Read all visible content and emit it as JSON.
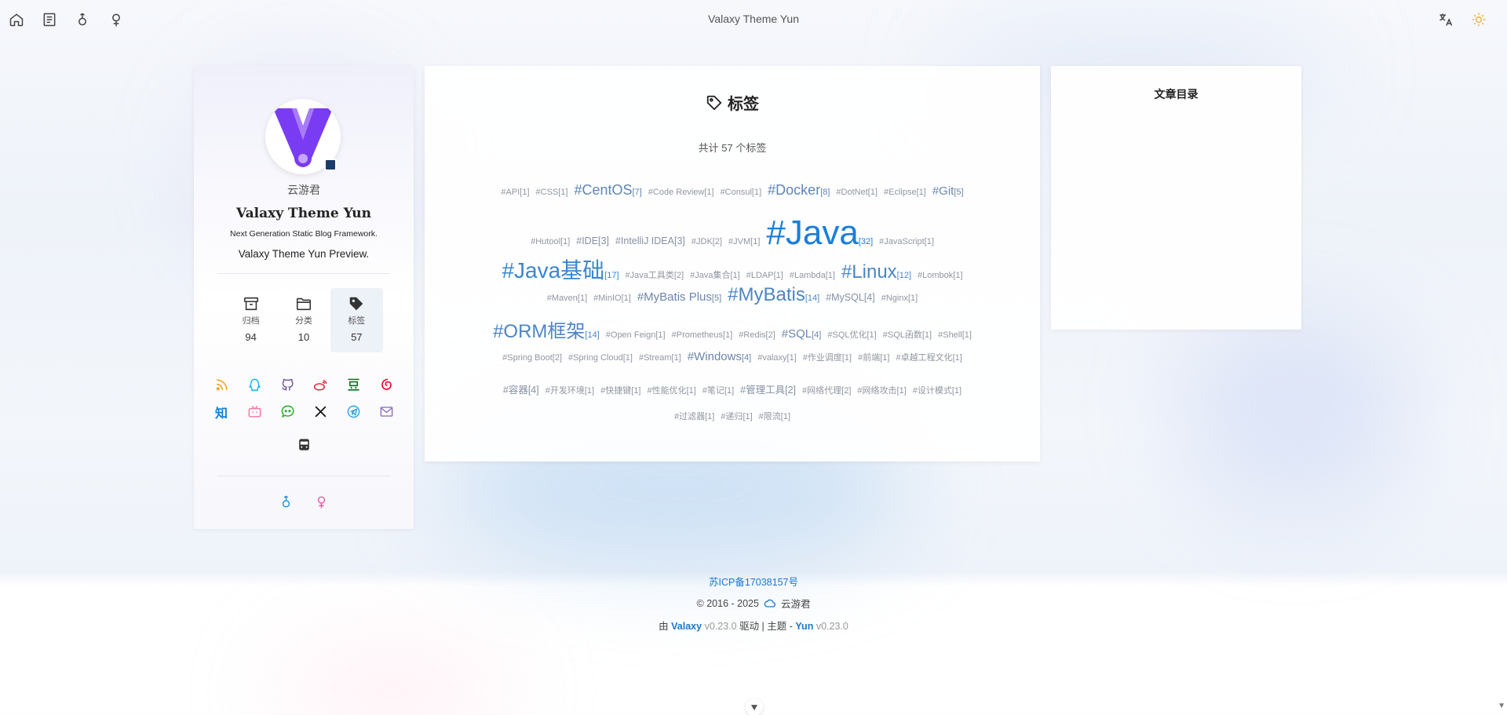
{
  "header": {
    "title": "Valaxy Theme Yun",
    "left_icons": [
      "home-icon",
      "document-icon",
      "male-icon",
      "female-icon"
    ],
    "right_icons": [
      "translate-icon",
      "sun-icon"
    ]
  },
  "profile": {
    "author": "云游君",
    "site_name": "Valaxy Theme Yun",
    "subtitle": "Next Generation Static Blog Framework.",
    "description": "Valaxy Theme Yun Preview.",
    "stats": [
      {
        "label": "归档",
        "value": "94",
        "icon": "archive-icon"
      },
      {
        "label": "分类",
        "value": "10",
        "icon": "folder-icon"
      },
      {
        "label": "标签",
        "value": "57",
        "icon": "tag-icon"
      }
    ],
    "social_row1": [
      "rss-icon",
      "qq-icon",
      "github-icon",
      "weibo-icon",
      "douban-icon",
      "netease-music-icon"
    ],
    "social_row2_zhihu": "知",
    "social_row2": [
      "bilibili-icon",
      "wechat-icon",
      "x-icon",
      "telegram-icon",
      "email-icon"
    ],
    "social_row3": [
      "travelling-icon"
    ]
  },
  "tags_page": {
    "title": "标签",
    "count_text": "共计 57 个标签",
    "lines": [
      [
        {
          "name": "#API",
          "count": "[1]",
          "size": 1
        },
        {
          "name": "#CSS",
          "count": "[1]",
          "size": 1
        },
        {
          "name": "#CentOS",
          "count": "[7]",
          "size": 4
        },
        {
          "name": "#Code Review",
          "count": "[1]",
          "size": 1
        },
        {
          "name": "#Consul",
          "count": "[1]",
          "size": 1
        },
        {
          "name": "#Docker",
          "count": "[8]",
          "size": 4
        },
        {
          "name": "#DotNet",
          "count": "[1]",
          "size": 1
        },
        {
          "name": "#Eclipse",
          "count": "[1]",
          "size": 1
        },
        {
          "name": "#Git",
          "count": "[5]",
          "size": 3
        }
      ],
      [
        {
          "name": "#Hutool",
          "count": "[1]",
          "size": 1
        },
        {
          "name": "#IDE",
          "count": "[3]",
          "size": 2
        },
        {
          "name": "#IntelliJ IDEA",
          "count": "[3]",
          "size": 2
        },
        {
          "name": "#JDK",
          "count": "[2]",
          "size": 1
        },
        {
          "name": "#JVM",
          "count": "[1]",
          "size": 1
        },
        {
          "name": "#Java",
          "count": "[32]",
          "size": 7
        },
        {
          "name": "#JavaScript",
          "count": "[1]",
          "size": 1
        }
      ],
      [
        {
          "name": "#Java基础",
          "count": "[17]",
          "size": 6
        },
        {
          "name": "#Java工具类",
          "count": "[2]",
          "size": 1
        },
        {
          "name": "#Java集合",
          "count": "[1]",
          "size": 1
        },
        {
          "name": "#LDAP",
          "count": "[1]",
          "size": 1
        },
        {
          "name": "#Lambda",
          "count": "[1]",
          "size": 1
        },
        {
          "name": "#Linux",
          "count": "[12]",
          "size": 5
        },
        {
          "name": "#Lombok",
          "count": "[1]",
          "size": 1
        }
      ],
      [
        {
          "name": "#Maven",
          "count": "[1]",
          "size": 1
        },
        {
          "name": "#MinIO",
          "count": "[1]",
          "size": 1
        },
        {
          "name": "#MyBatis Plus",
          "count": "[5]",
          "size": 3
        },
        {
          "name": "#MyBatis",
          "count": "[14]",
          "size": 5
        },
        {
          "name": "#MySQL",
          "count": "[4]",
          "size": 2
        },
        {
          "name": "#Nginx",
          "count": "[1]",
          "size": 1
        }
      ],
      [
        {
          "name": "#ORM框架",
          "count": "[14]",
          "size": 5
        },
        {
          "name": "#Open Feign",
          "count": "[1]",
          "size": 1
        },
        {
          "name": "#Prometheus",
          "count": "[1]",
          "size": 1
        },
        {
          "name": "#Redis",
          "count": "[2]",
          "size": 1
        },
        {
          "name": "#SQL",
          "count": "[4]",
          "size": 3
        },
        {
          "name": "#SQL优化",
          "count": "[1]",
          "size": 1
        },
        {
          "name": "#SQL函数",
          "count": "[1]",
          "size": 1
        },
        {
          "name": "#Shell",
          "count": "[1]",
          "size": 1
        }
      ],
      [
        {
          "name": "#Spring Boot",
          "count": "[2]",
          "size": 1
        },
        {
          "name": "#Spring Cloud",
          "count": "[1]",
          "size": 1
        },
        {
          "name": "#Stream",
          "count": "[1]",
          "size": 1
        },
        {
          "name": "#Windows",
          "count": "[4]",
          "size": 3
        },
        {
          "name": "#valaxy",
          "count": "[1]",
          "size": 1
        },
        {
          "name": "#作业调度",
          "count": "[1]",
          "size": 1
        },
        {
          "name": "#前端",
          "count": "[1]",
          "size": 1
        },
        {
          "name": "#卓越工程文化",
          "count": "[1]",
          "size": 1
        }
      ],
      [
        {
          "name": "#容器",
          "count": "[4]",
          "size": 2
        },
        {
          "name": "#开发环境",
          "count": "[1]",
          "size": 1
        },
        {
          "name": "#快捷键",
          "count": "[1]",
          "size": 1
        },
        {
          "name": "#性能优化",
          "count": "[1]",
          "size": 1
        },
        {
          "name": "#笔记",
          "count": "[1]",
          "size": 1
        },
        {
          "name": "#管理工具",
          "count": "[2]",
          "size": 2
        },
        {
          "name": "#网络代理",
          "count": "[2]",
          "size": 1
        },
        {
          "name": "#网络攻击",
          "count": "[1]",
          "size": 1
        },
        {
          "name": "#设计模式",
          "count": "[1]",
          "size": 1
        }
      ],
      [
        {
          "name": "#过滤器",
          "count": "[1]",
          "size": 1
        },
        {
          "name": "#递归",
          "count": "[1]",
          "size": 1
        },
        {
          "name": "#限流",
          "count": "[1]",
          "size": 1
        }
      ]
    ]
  },
  "toc": {
    "title": "文章目录"
  },
  "footer": {
    "icp": "苏ICP备17038157号",
    "copyright": "© 2016 - 2025",
    "author": "云游君",
    "powered_prefix": "由",
    "valaxy": "Valaxy",
    "valaxy_version": "v0.23.0",
    "powered_mid": "驱动 | 主题 -",
    "theme": "Yun",
    "theme_version": "v0.23.0"
  },
  "colors": {
    "accent": "#1a7fd9",
    "avatar_purple": "#7a3cf2"
  }
}
